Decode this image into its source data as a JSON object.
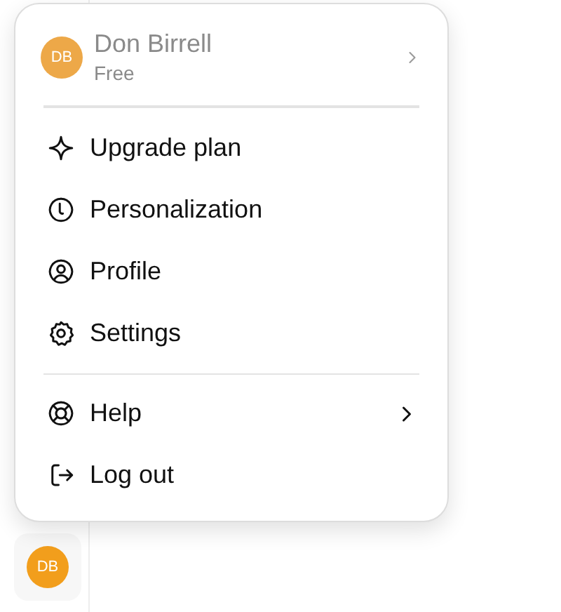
{
  "account": {
    "initials": "DB",
    "name": "Don Birrell",
    "plan": "Free",
    "disabled": true,
    "has_submenu": true
  },
  "sections": [
    [
      {
        "label": "Upgrade plan",
        "has_submenu": false
      },
      {
        "label": "Personalization",
        "has_submenu": false
      },
      {
        "label": "Profile",
        "has_submenu": false
      },
      {
        "label": "Settings",
        "has_submenu": false
      }
    ],
    [
      {
        "label": "Help",
        "has_submenu": true
      },
      {
        "label": "Log out",
        "has_submenu": false
      }
    ]
  ],
  "sidebar_avatar": {
    "initials": "DB"
  }
}
